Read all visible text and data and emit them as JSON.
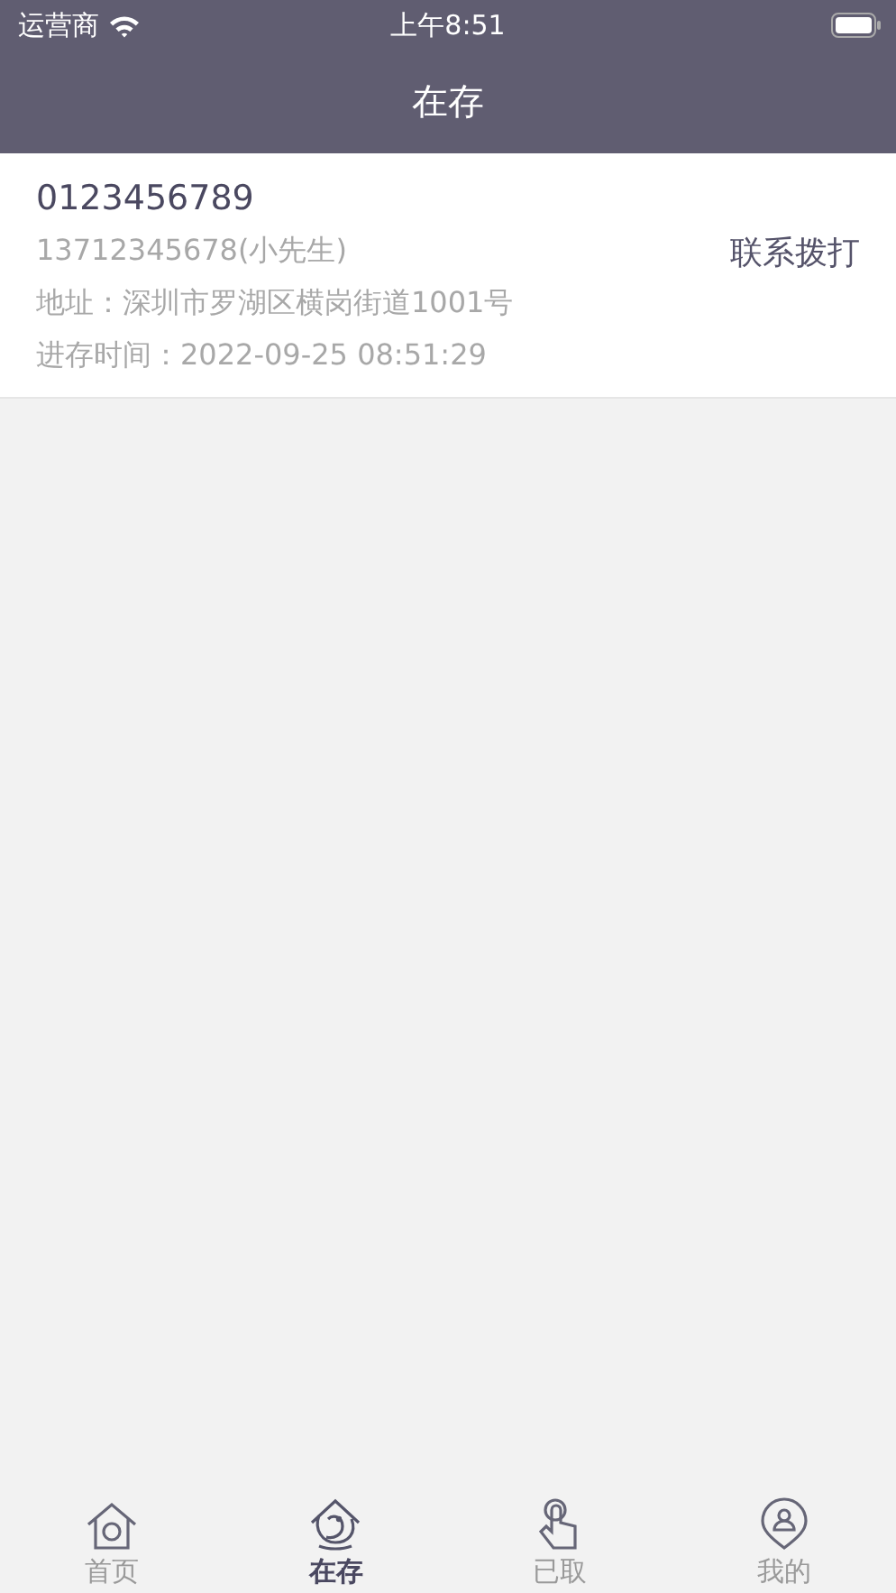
{
  "status_bar": {
    "carrier": "运营商",
    "time": "上午8:51"
  },
  "nav": {
    "title": "在存"
  },
  "items": [
    {
      "tracking_number": "0123456789",
      "phone": "13712345678(小先生)",
      "address": "地址：深圳市罗湖区横岗街道1001号",
      "time": "进存时间：2022-09-25 08:51:29",
      "call_label": "联系拨打"
    }
  ],
  "tabs": [
    {
      "label": "首页",
      "kind": "home",
      "selected": false
    },
    {
      "label": "在存",
      "kind": "bird",
      "selected": true
    },
    {
      "label": "已取",
      "kind": "hand",
      "selected": false
    },
    {
      "label": "我的",
      "kind": "user",
      "selected": false
    }
  ]
}
